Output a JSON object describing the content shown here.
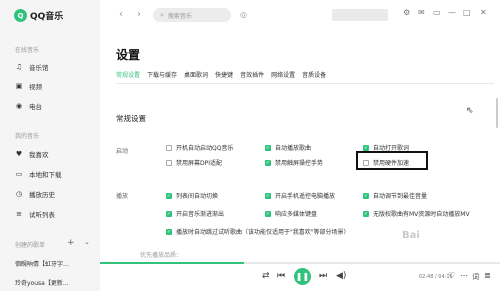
{
  "app": {
    "name": "QQ音乐",
    "logo_glyph": "Q"
  },
  "sidebar": {
    "online_title": "在线音乐",
    "online_items": [
      {
        "icon": "music-note-icon",
        "glyph": "♫",
        "label": "音乐馆"
      },
      {
        "icon": "video-icon",
        "glyph": "▣",
        "label": "视频"
      },
      {
        "icon": "radio-icon",
        "glyph": "◉",
        "label": "电台"
      }
    ],
    "mine_title": "我的音乐",
    "mine_items": [
      {
        "icon": "heart-icon",
        "glyph": "♥",
        "label": "我喜欢"
      },
      {
        "icon": "computer-icon",
        "glyph": "▭",
        "label": "本地和下载"
      },
      {
        "icon": "history-icon",
        "glyph": "◷",
        "label": "播放历史"
      },
      {
        "icon": "list-icon",
        "glyph": "≡",
        "label": "试听列表"
      }
    ],
    "created_title": "创建的歌单",
    "playlists": [
      "徊睍晌倩【虹牙字...",
      "玲奇yousa【更新..."
    ]
  },
  "topbar": {
    "back": "‹",
    "forward": "›",
    "search_placeholder": "搜索音乐",
    "search_glyph": "⌕",
    "mic_glyph": "◎",
    "window_icons": [
      "⚙",
      "✉",
      "▭",
      "—",
      "□",
      "✕"
    ]
  },
  "settings": {
    "title": "设置",
    "tabs": [
      "常规设置",
      "下载与缓存",
      "桌面歌词",
      "快捷键",
      "音效插件",
      "网络设置",
      "音质设备"
    ],
    "active_tab": 0,
    "section": "常规设置",
    "startup_label": "启动",
    "startup_options": [
      {
        "label": "开机自动启动QQ音乐",
        "checked": false
      },
      {
        "label": "自动播放歌曲",
        "checked": true
      },
      {
        "label": "自动打开歌词",
        "checked": true
      },
      {
        "label": "禁用屏幕DPI适配",
        "checked": false
      },
      {
        "label": "禁用触屏操控手势",
        "checked": true
      },
      {
        "label": "禁用硬件加速",
        "checked": false
      }
    ],
    "play_label": "播放",
    "play_options": [
      {
        "label": "列表间自动切换",
        "checked": true
      },
      {
        "label": "开启手机遥控电脑播放",
        "checked": true
      },
      {
        "label": "自动调节到最佳音量",
        "checked": true
      },
      {
        "label": "开启音乐渐进渐出",
        "checked": true
      },
      {
        "label": "响应多媒体键盘",
        "checked": true
      },
      {
        "label": "无版权歌曲有MV资源时自动播放MV",
        "checked": true
      },
      {
        "label": "播放时自动跳过试听歌曲（该功能仅适用于\"我喜欢\"等部分场景）",
        "checked": true
      }
    ],
    "partial_text": "优先播放品质："
  },
  "player": {
    "progress": 0.36,
    "time": "02:48 / 04:15",
    "controls": [
      "⇄",
      "⏮",
      "❚❚",
      "⏭",
      "◀)"
    ],
    "extra_icons": [
      "♡",
      "⋯",
      "词",
      "≣"
    ]
  },
  "colors": {
    "accent": "#31c27c",
    "sidebar_bg": "#f5f5f5"
  }
}
